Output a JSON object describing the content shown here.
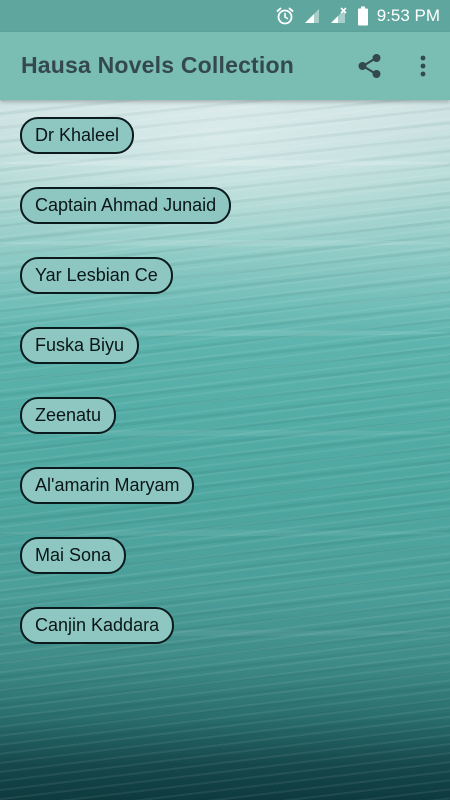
{
  "status_bar": {
    "time": "9:53 PM",
    "icons": [
      "alarm-icon",
      "signal-icon",
      "no-signal-icon",
      "battery-icon"
    ]
  },
  "app_bar": {
    "title": "Hausa Novels Collection",
    "actions": [
      "share-icon",
      "more-vert-icon"
    ]
  },
  "novels": [
    {
      "label": "Dr Khaleel"
    },
    {
      "label": "Captain Ahmad Junaid"
    },
    {
      "label": "Yar Lesbian Ce"
    },
    {
      "label": "Fuska Biyu"
    },
    {
      "label": "Zeenatu"
    },
    {
      "label": "Al'amarin Maryam"
    },
    {
      "label": "Mai Sona"
    },
    {
      "label": "Canjin Kaddara"
    }
  ],
  "colors": {
    "status_bar": "#5fa79e",
    "app_bar": "#7abdb3",
    "title_text": "#34484f",
    "button_fill": "#8ec6c1",
    "button_border": "#0b1a1c"
  }
}
